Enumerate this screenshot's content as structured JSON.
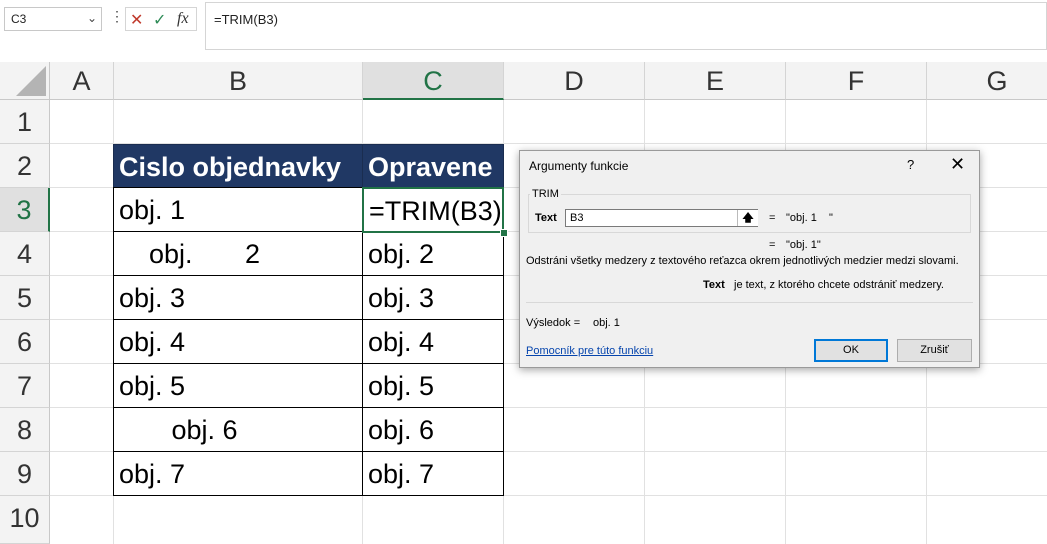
{
  "formula_bar": {
    "name_box": "C3",
    "formula": "=TRIM(B3)"
  },
  "columns": [
    "A",
    "B",
    "C",
    "D",
    "E",
    "F",
    "G"
  ],
  "rows": [
    "1",
    "2",
    "3",
    "4",
    "5",
    "6",
    "7",
    "8",
    "9",
    "10"
  ],
  "selected_cell": "C3",
  "table": {
    "header_b": "Cislo objednavky",
    "header_c": "Opravene",
    "b": [
      "obj. 1",
      "    obj.       2",
      "obj. 3",
      "obj. 4",
      "obj. 5",
      "       obj. 6",
      "obj. 7"
    ],
    "c": [
      "=TRIM(B3)",
      "obj. 2",
      "obj. 3",
      "obj. 4",
      "obj. 5",
      "obj. 6",
      "obj. 7"
    ]
  },
  "colors": {
    "header_fill": "#203864",
    "selection": "#217346"
  },
  "dialog": {
    "title": "Argumenty funkcie",
    "help": "?",
    "function_name": "TRIM",
    "arg_label": "Text",
    "arg_value": "B3",
    "arg_result": "\"obj. 1    \"",
    "func_result": "\"obj. 1\"",
    "equals": "=",
    "description": "Odstráni všetky medzery z textového reťazca okrem jednotlivých medzier medzi slovami.",
    "arg_desc_label": "Text",
    "arg_desc": "je text, z ktorého chcete odstrániť medzery.",
    "result_label": "Výsledok =",
    "result_value": "obj. 1",
    "help_link": "Pomocník pre túto funkciu",
    "ok": "OK",
    "cancel": "Zrušiť"
  }
}
